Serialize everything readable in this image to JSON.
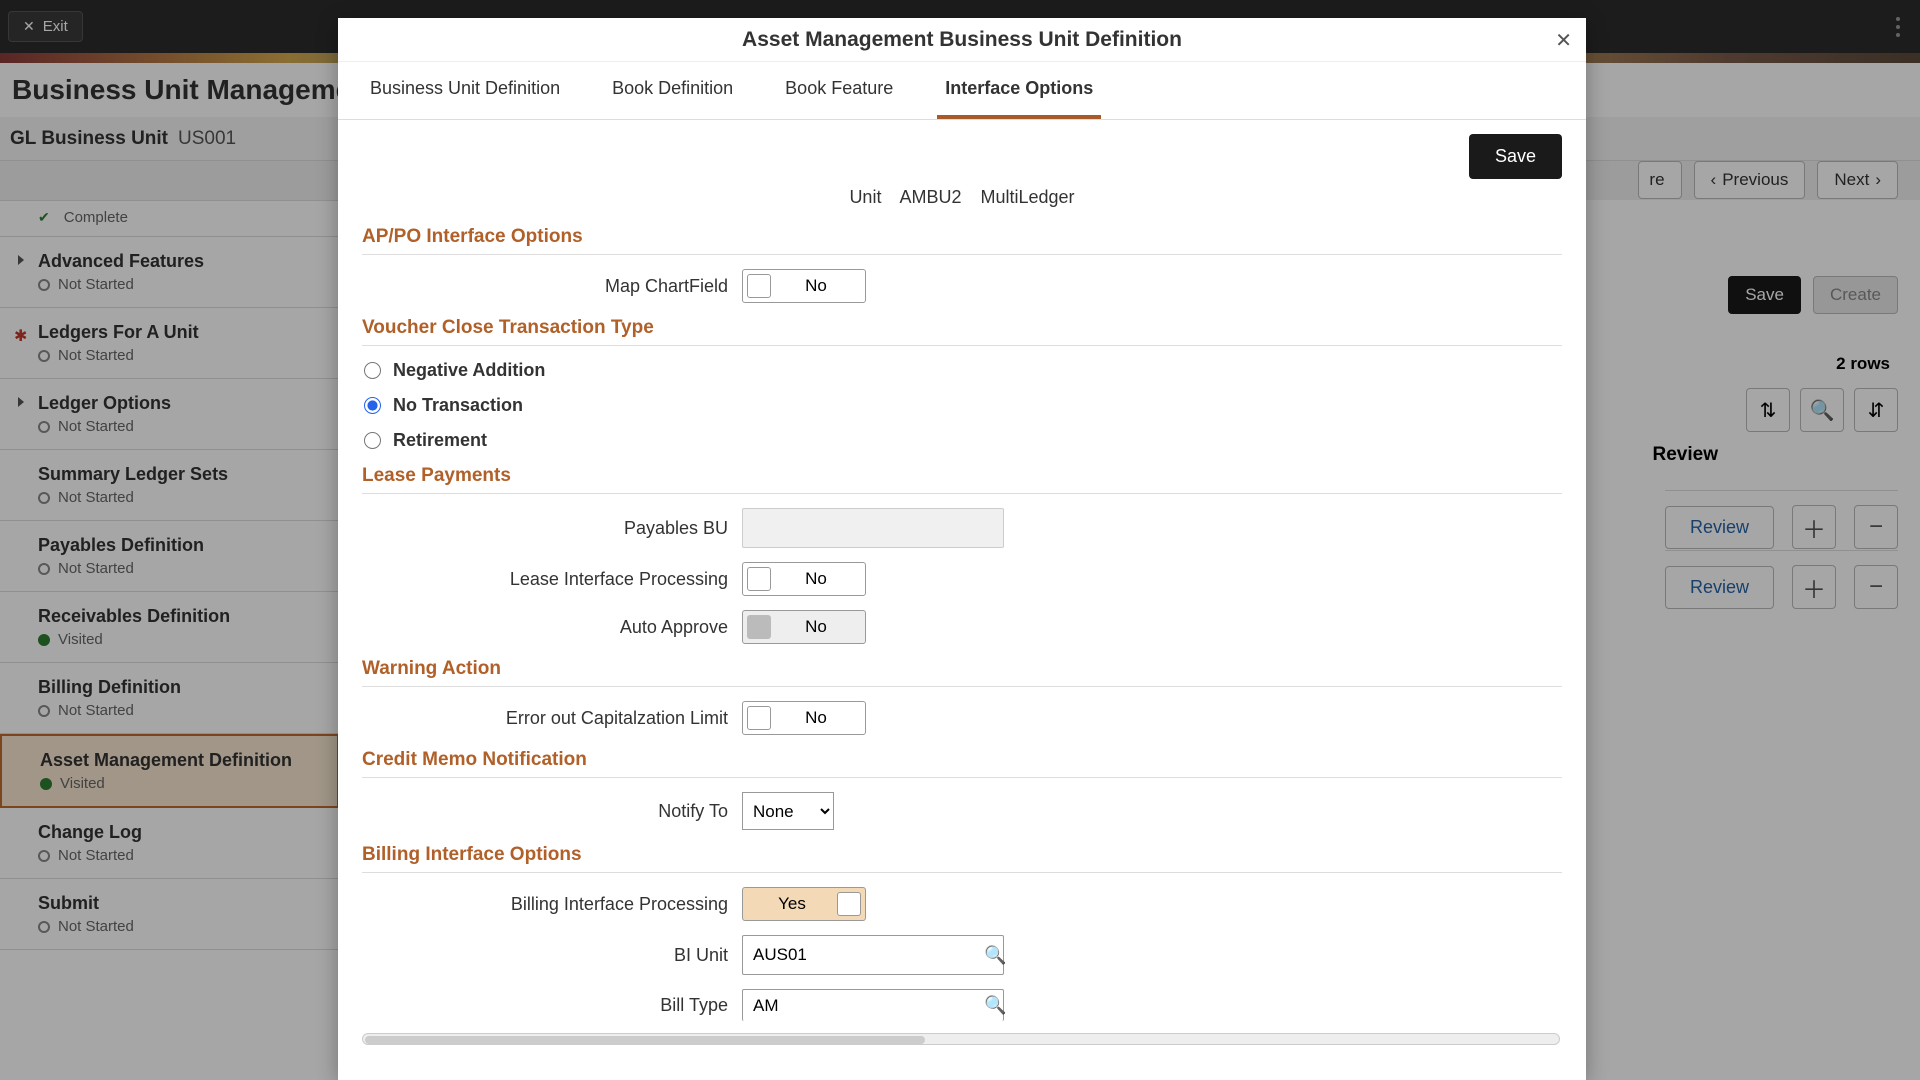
{
  "topbar": {
    "exit": "Exit"
  },
  "page_title": "Business Unit Management",
  "sub_header": {
    "label": "GL Business Unit",
    "value": "US001",
    "feature_cut": "re",
    "prev": "Previous",
    "next": "Next",
    "save": "Save",
    "create": "Create"
  },
  "sidebar": {
    "complete_status": "Complete",
    "items": [
      {
        "title": "Advanced Features",
        "status": "Not Started",
        "caret": true
      },
      {
        "title": "Ledgers For A Unit",
        "status": "Not Started",
        "star": true
      },
      {
        "title": "Ledger Options",
        "status": "Not Started",
        "caret": true
      },
      {
        "title": "Summary Ledger Sets",
        "status": "Not Started"
      },
      {
        "title": "Payables Definition",
        "status": "Not Started"
      },
      {
        "title": "Receivables Definition",
        "status": "Visited",
        "visited": true
      },
      {
        "title": "Billing Definition",
        "status": "Not Started"
      },
      {
        "title": "Asset Management Definition",
        "status": "Visited",
        "visited": true,
        "active": true
      },
      {
        "title": "Change Log",
        "status": "Not Started"
      },
      {
        "title": "Submit",
        "status": "Not Started"
      }
    ]
  },
  "grid": {
    "rows_label": "2 rows",
    "review_col": "Review",
    "review_btn": "Review"
  },
  "modal": {
    "title": "Asset Management Business Unit Definition",
    "tabs": [
      "Business Unit Definition",
      "Book Definition",
      "Book Feature",
      "Interface Options"
    ],
    "active_tab": 3,
    "save": "Save",
    "unit_label": "Unit",
    "unit_value": "AMBU2",
    "unit_desc": "MultiLedger",
    "sections": {
      "appo": "AP/PO Interface Options",
      "map_cf": "Map ChartField",
      "vct": "Voucher Close Transaction Type",
      "neg_add": "Negative Addition",
      "no_txn": "No Transaction",
      "retire": "Retirement",
      "lease": "Lease Payments",
      "pay_bu": "Payables BU",
      "lip": "Lease Interface Processing",
      "auto": "Auto Approve",
      "warn": "Warning Action",
      "err_cap": "Error out Capitalzation Limit",
      "credit": "Credit Memo Notification",
      "notify": "Notify To",
      "notify_val": "None",
      "billing": "Billing Interface Options",
      "bip": "Billing Interface Processing",
      "bi_unit": "BI Unit",
      "bi_unit_val": "AUS01",
      "bill_type": "Bill Type",
      "bill_type_val": "AM",
      "no": "No",
      "yes": "Yes"
    }
  }
}
